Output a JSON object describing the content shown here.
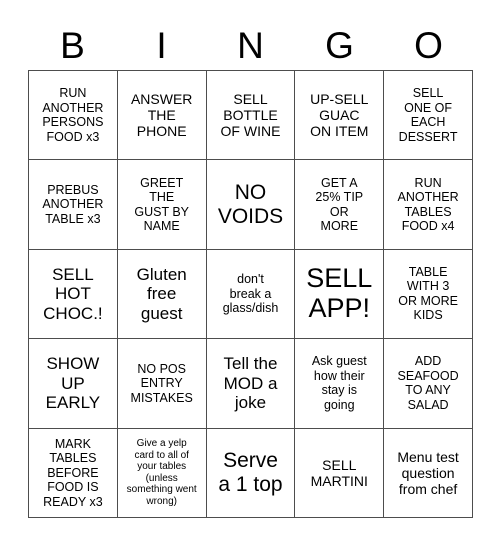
{
  "card": {
    "title": "BINGO",
    "header_letters": [
      "B",
      "I",
      "N",
      "G",
      "O"
    ],
    "grid": {
      "columns": 5,
      "rows": 5,
      "border_color": "#4d4d4d",
      "background_color": "#ffffff",
      "text_color": "#000000"
    },
    "cells": [
      {
        "text": "RUN\nANOTHER\nPERSONS\nFOOD x3",
        "size": "sm"
      },
      {
        "text": "ANSWER\nTHE\nPHONE",
        "size": "md"
      },
      {
        "text": "SELL\nBOTTLE\nOF WINE",
        "size": "md"
      },
      {
        "text": "UP-SELL\nGUAC\nON ITEM",
        "size": "md"
      },
      {
        "text": "SELL\nONE OF\nEACH\nDESSERT",
        "size": "sm"
      },
      {
        "text": "PREBUS\nANOTHER\nTABLE x3",
        "size": "sm"
      },
      {
        "text": "GREET\nTHE\nGUST BY\nNAME",
        "size": "sm"
      },
      {
        "text": "NO\nVOIDS",
        "size": "xl"
      },
      {
        "text": "GET A\n25% TIP\nOR\nMORE",
        "size": "sm"
      },
      {
        "text": "RUN\nANOTHER\nTABLES\nFOOD x4",
        "size": "sm"
      },
      {
        "text": "SELL\nHOT\nCHOC.!",
        "size": "lg"
      },
      {
        "text": "Gluten\nfree\nguest",
        "size": "lg"
      },
      {
        "text": "don't\nbreak a\nglass/dish",
        "size": "sm"
      },
      {
        "text": "SELL\nAPP!",
        "size": "xxl"
      },
      {
        "text": "TABLE\nWITH 3\nOR MORE\nKIDS",
        "size": "sm"
      },
      {
        "text": "SHOW\nUP\nEARLY",
        "size": "lg"
      },
      {
        "text": "NO POS\nENTRY\nMISTAKES",
        "size": "sm"
      },
      {
        "text": "Tell the\nMOD a\njoke",
        "size": "lg"
      },
      {
        "text": "Ask guest\nhow their\nstay is\ngoing",
        "size": "sm"
      },
      {
        "text": "ADD\nSEAFOOD\nTO ANY\nSALAD",
        "size": "sm"
      },
      {
        "text": "MARK\nTABLES\nBEFORE\nFOOD IS\nREADY x3",
        "size": "sm"
      },
      {
        "text": "Give a yelp\ncard to all of\nyour tables\n(unless\nsomething went\nwrong)",
        "size": "xs"
      },
      {
        "text": "Serve\na 1 top",
        "size": "xl"
      },
      {
        "text": "SELL\nMARTINI",
        "size": "md"
      },
      {
        "text": "Menu test\nquestion\nfrom chef",
        "size": "md"
      }
    ]
  }
}
